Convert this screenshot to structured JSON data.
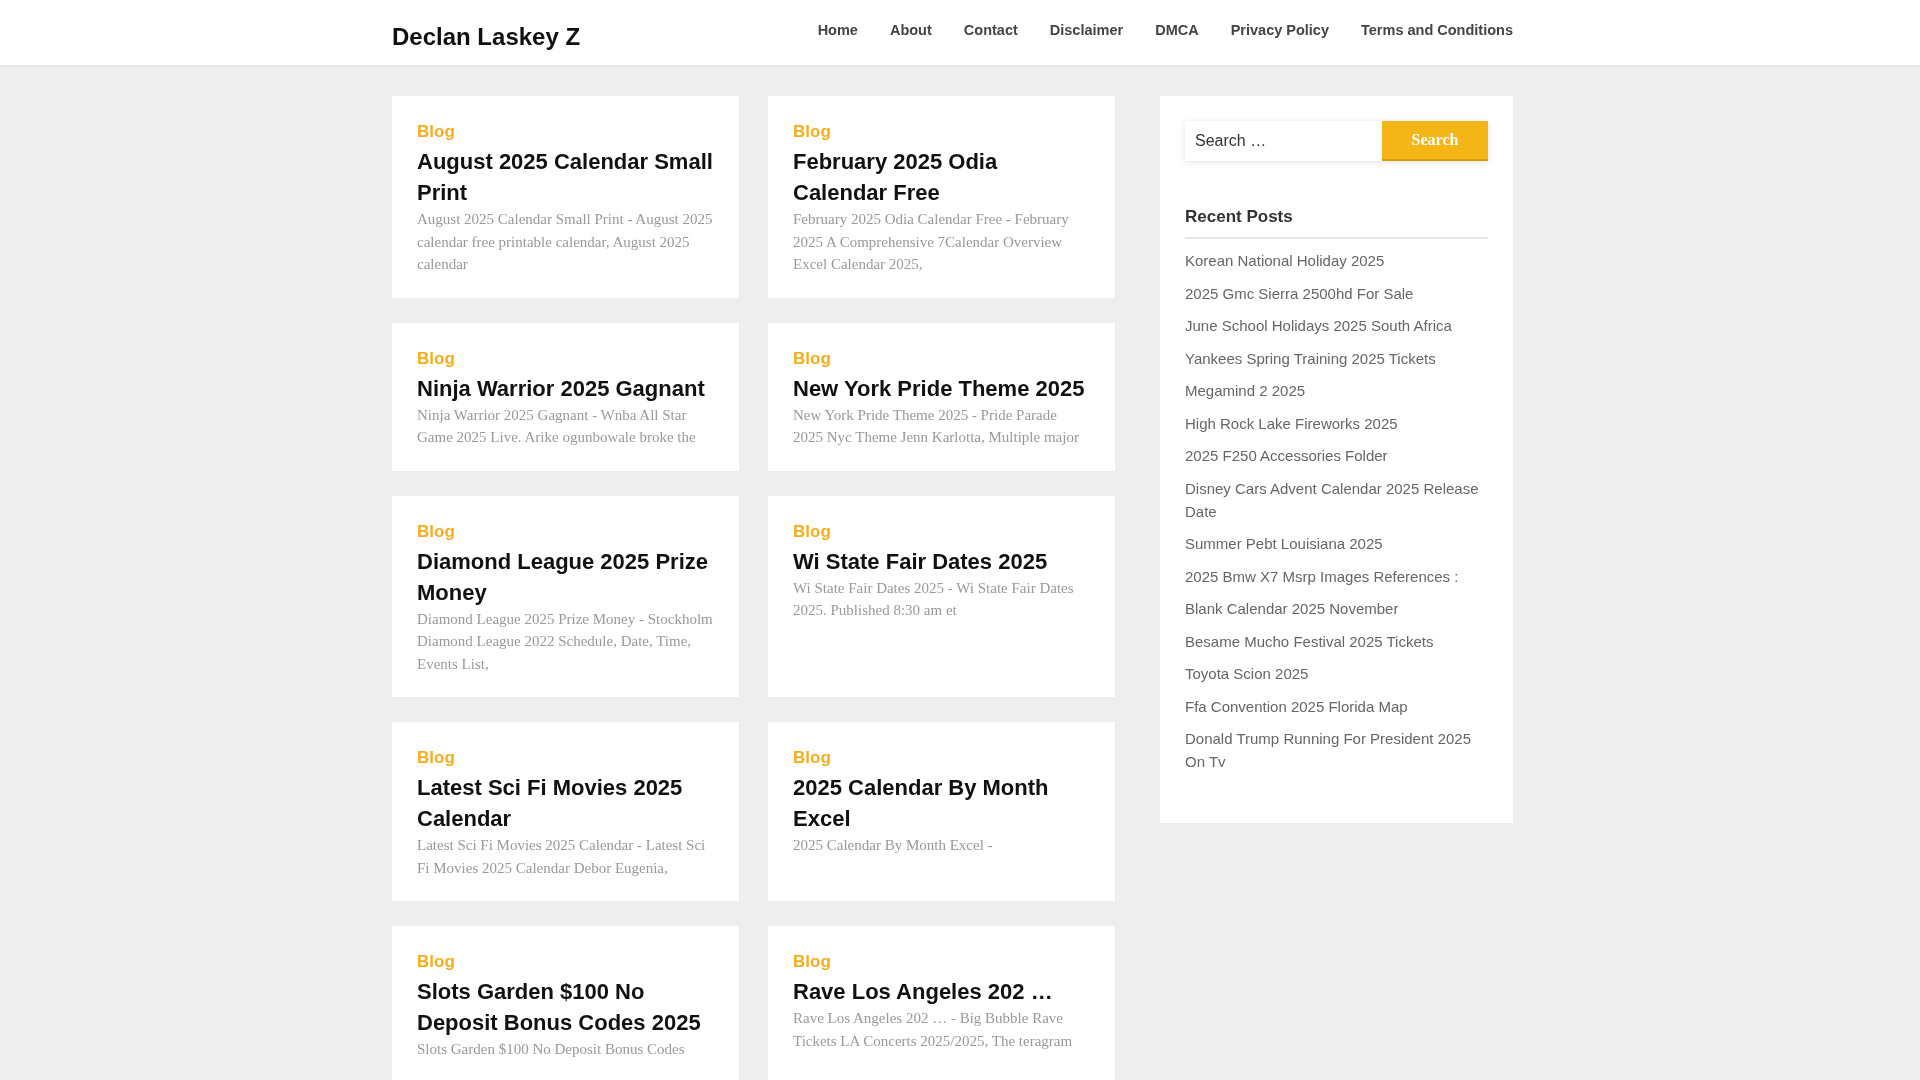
{
  "site_title": "Declan Laskey Z",
  "nav": [
    "Home",
    "About",
    "Contact",
    "Disclaimer",
    "DMCA",
    "Privacy Policy",
    "Terms and Conditions"
  ],
  "posts": [
    {
      "category": "Blog",
      "title": "August 2025 Calendar Small Print",
      "excerpt": "August 2025 Calendar Small Print - August 2025 calendar free printable calendar, August 2025 calendar"
    },
    {
      "category": "Blog",
      "title": "February 2025 Odia Calendar Free",
      "excerpt": "February 2025 Odia Calendar Free - February 2025 A Comprehensive 7Calendar Overview Excel Calendar 2025,"
    },
    {
      "category": "Blog",
      "title": "Ninja Warrior 2025 Gagnant",
      "excerpt": "Ninja Warrior 2025 Gagnant - Wnba All Star Game 2025 Live. Arike ogunbowale broke the"
    },
    {
      "category": "Blog",
      "title": "New York Pride Theme 2025",
      "excerpt": "New York Pride Theme 2025 - Pride Parade 2025 Nyc Theme Jenn Karlotta, Multiple major"
    },
    {
      "category": "Blog",
      "title": "Diamond League 2025 Prize Money",
      "excerpt": "Diamond League 2025 Prize Money - Stockholm Diamond League 2022 Schedule, Date, Time, Events List,"
    },
    {
      "category": "Blog",
      "title": "Wi State Fair Dates 2025",
      "excerpt": "Wi State Fair Dates 2025 - Wi State Fair Dates 2025. Published 8:30 am et"
    },
    {
      "category": "Blog",
      "title": "Latest Sci Fi Movies 2025 Calendar",
      "excerpt": "Latest Sci Fi Movies 2025 Calendar - Latest Sci Fi Movies 2025 Calendar Debor Eugenia,"
    },
    {
      "category": "Blog",
      "title": "2025 Calendar By Month Excel",
      "excerpt": "2025 Calendar By Month Excel -"
    },
    {
      "category": "Blog",
      "title": "Slots Garden $100 No Deposit Bonus Codes 2025",
      "excerpt": "Slots Garden $100 No Deposit Bonus Codes"
    },
    {
      "category": "Blog",
      "title": "Rave Los Angeles 202 …",
      "excerpt": "Rave Los Angeles 202 … - Big Bubble Rave Tickets LA Concerts 2025/2025, The teragram"
    }
  ],
  "sidebar": {
    "search": {
      "placeholder": "Search …",
      "button": "Search"
    },
    "recent_posts": {
      "title": "Recent Posts",
      "items": [
        "Korean National Holiday 2025",
        "2025 Gmc Sierra 2500hd For Sale",
        "June School Holidays 2025 South Africa",
        "Yankees Spring Training 2025 Tickets",
        "Megamind 2 2025",
        "High Rock Lake Fireworks 2025",
        "2025 F250 Accessories Folder",
        "Disney Cars Advent Calendar 2025 Release Date",
        "Summer Pebt Louisiana 2025",
        "2025 Bmw X7 Msrp Images References :",
        "Blank Calendar 2025 November",
        "Besame Mucho Festival 2025 Tickets",
        "Toyota Scion 2025",
        "Ffa Convention 2025 Florida Map",
        "Donald Trump Running For President 2025 On Tv"
      ]
    }
  }
}
